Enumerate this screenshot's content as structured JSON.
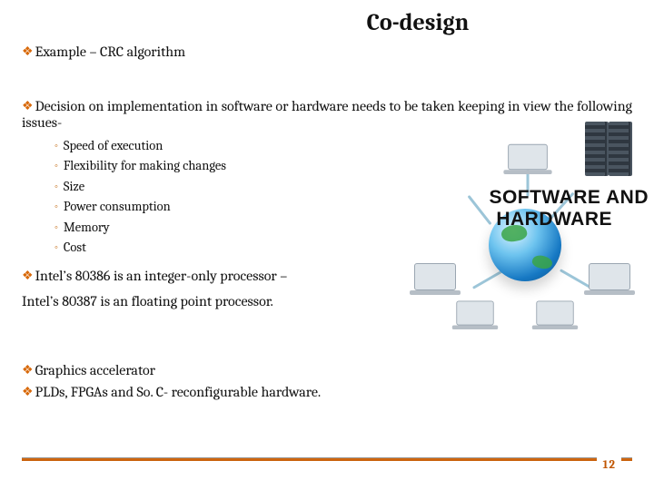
{
  "title": "Co-design",
  "b1": "Example – CRC algorithm",
  "b2": "Decision on implementation in software or hardware needs to be taken keeping in view the following issues-",
  "issues": {
    "i0": "Speed of execution",
    "i1": "Flexibility for making changes",
    "i2": "Size",
    "i3": "Power consumption",
    "i4": "Memory",
    "i5": "Cost"
  },
  "b3": "Intel’s 80386 is an integer-only processor –",
  "p4": "Intel’s 80387 is an floating point processor.",
  "b5": "Graphics accelerator",
  "b6": "PLDs, FPGAs and So. C- reconfigurable hardware.",
  "illus": {
    "line1": "SOFTWARE AND",
    "line2": "HARDWARE"
  },
  "page": "12"
}
